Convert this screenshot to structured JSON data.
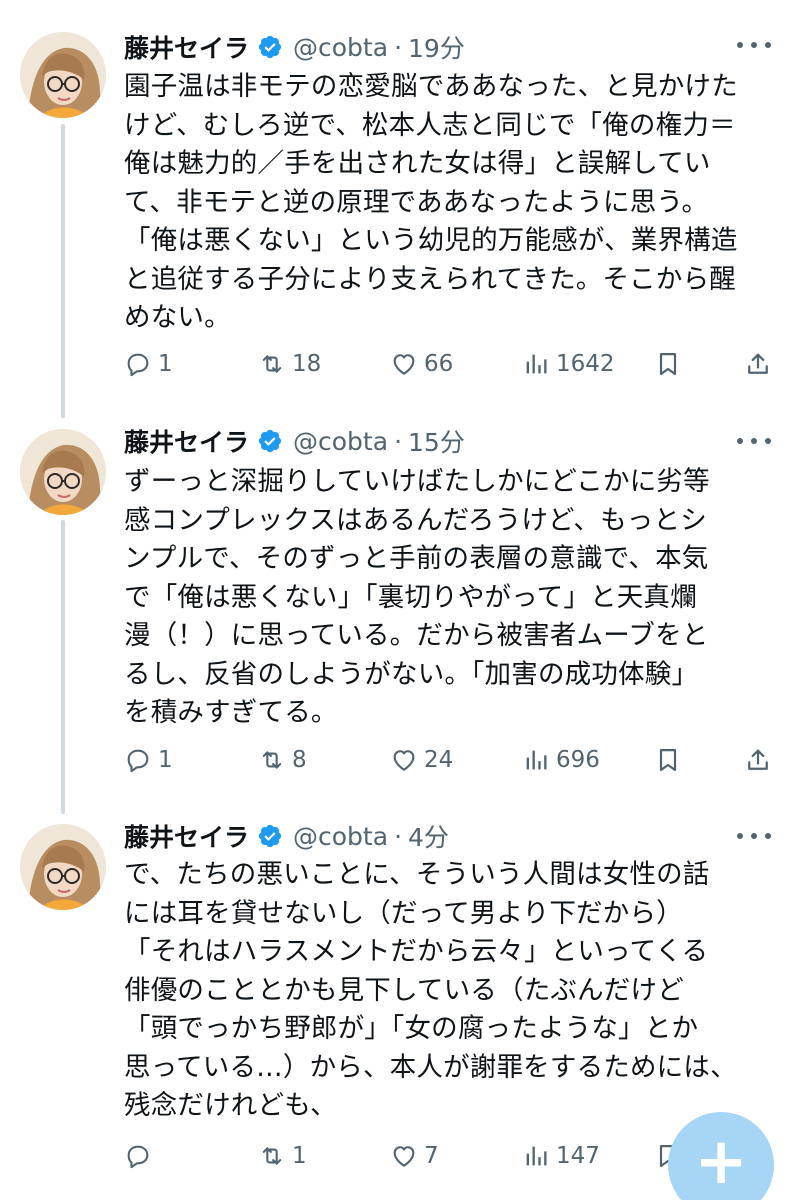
{
  "tweets": [
    {
      "name": "藤井セイラ",
      "handle": "@cobta",
      "separator": "·",
      "time": "19分",
      "text": "園子温は非モテの恋愛脳でああなった、と見かけた\nけど、むしろ逆で、松本人志と同じで「俺の権力＝\n俺は魅力的／手を出された女は得」と誤解してい\nて、非モテと逆の原理でああなったように思う。\n「俺は悪くない」という幼児的万能感が、業界構造\nと追従する子分により支えられてきた。そこから醒\nめない。",
      "replies": "1",
      "retweets": "18",
      "likes": "66",
      "views": "1642"
    },
    {
      "name": "藤井セイラ",
      "handle": "@cobta",
      "separator": "·",
      "time": "15分",
      "text": "ずーっと深掘りしていけばたしかにどこかに劣等\n感コンプレックスはあるんだろうけど、もっとシ\nンプルで、そのずっと手前の表層の意識で、本気\nで「俺は悪くない」「裏切りやがって」と天真爛\n漫（！）に思っている。だから被害者ムーブをと\nるし、反省のしようがない。「加害の成功体験」\nを積みすぎてる。",
      "replies": "1",
      "retweets": "8",
      "likes": "24",
      "views": "696"
    },
    {
      "name": "藤井セイラ",
      "handle": "@cobta",
      "separator": "·",
      "time": "4分",
      "text": "で、たちの悪いことに、そういう人間は女性の話\nには耳を貸せないし（だって男より下だから）\n「それはハラスメントだから云々」といってくる\n俳優のこととかも見下している（たぶんだけど\n「頭でっかち野郎が」「女の腐ったような」とか\n思っている…）から、本人が謝罪をするためには、\n残念だけれども、",
      "replies": "",
      "retweets": "1",
      "likes": "7",
      "views": "147"
    }
  ],
  "icons": {
    "verified": "verified-badge-icon",
    "more": "more-icon",
    "reply": "reply-icon",
    "retweet": "retweet-icon",
    "like": "heart-icon",
    "views": "views-icon",
    "bookmark": "bookmark-icon",
    "share": "share-icon",
    "compose": "plus-icon"
  },
  "fab_label": "+",
  "colors": {
    "text": "#0f1419",
    "secondary": "#536471",
    "verified": "#1d9bf0",
    "thread_line": "#cfd9de",
    "fab": "#a7d5f6"
  }
}
